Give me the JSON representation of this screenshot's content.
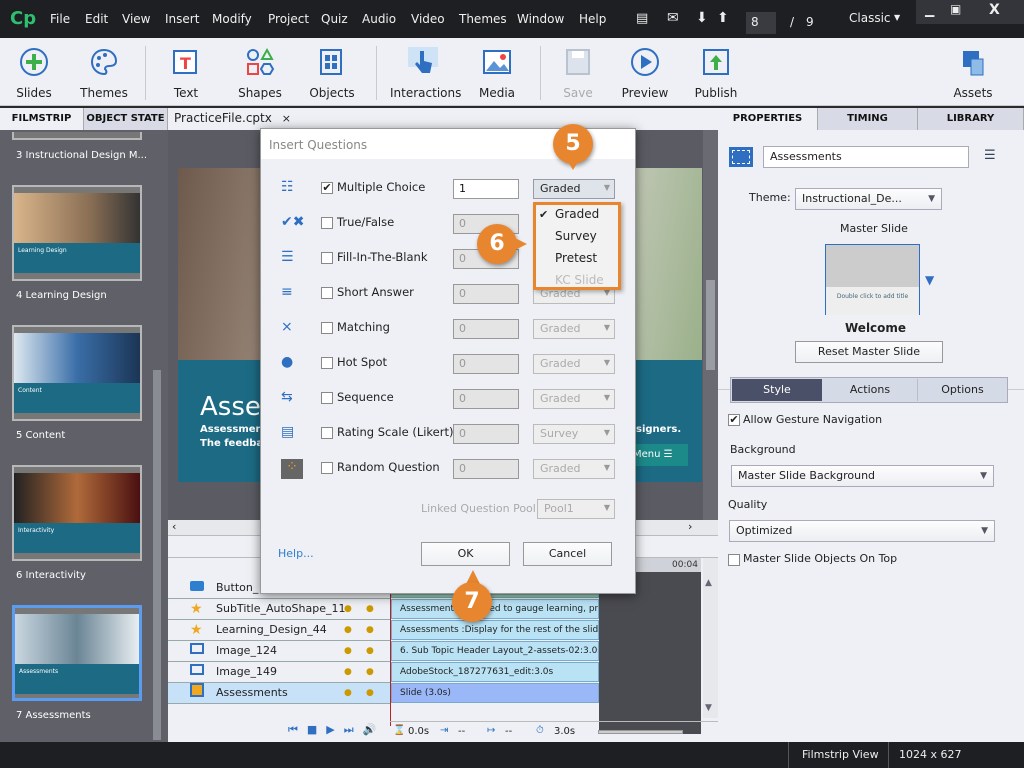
{
  "app": {
    "logo": "Cp",
    "menu": [
      "File",
      "Edit",
      "View",
      "Insert",
      "Modify",
      "Project",
      "Quiz",
      "Audio",
      "Video",
      "Themes",
      "Window",
      "Help"
    ],
    "slide_current": "8",
    "slide_sep": "/",
    "slide_total": "9",
    "workspace": "Classic"
  },
  "toolbar": {
    "items": [
      {
        "label": "Slides",
        "icon": "plus-circle-icon"
      },
      {
        "label": "Themes",
        "icon": "palette-icon"
      },
      {
        "label": "Text",
        "icon": "text-icon"
      },
      {
        "label": "Shapes",
        "icon": "shapes-icon"
      },
      {
        "label": "Objects",
        "icon": "objects-icon"
      },
      {
        "label": "Interactions",
        "icon": "hand-pointer-icon"
      },
      {
        "label": "Media",
        "icon": "image-icon"
      },
      {
        "label": "Save",
        "icon": "floppy-icon"
      },
      {
        "label": "Preview",
        "icon": "play-circle-icon"
      },
      {
        "label": "Publish",
        "icon": "upload-icon"
      },
      {
        "label": "Assets",
        "icon": "assets-icon"
      }
    ]
  },
  "left_tabs": [
    "FILMSTRIP",
    "OBJECT STATE"
  ],
  "doc_tab": {
    "label": "PracticeFile.cptx",
    "close": "×"
  },
  "right_tabs": [
    "PROPERTIES",
    "TIMING",
    "LIBRARY"
  ],
  "filmstrip": {
    "slides": [
      {
        "label": "3 Instructional Design M..."
      },
      {
        "label": "4 Learning Design",
        "title": "Learning Design"
      },
      {
        "label": "5 Content",
        "title": "Content"
      },
      {
        "label": "6 Interactivity",
        "title": "Interactivity"
      },
      {
        "label": "7 Assessments",
        "title": "Assessments"
      }
    ]
  },
  "stage": {
    "title": "Assess",
    "line1": "Assessments",
    "line2": "The feedback",
    "right_text": "signers.",
    "menu": "Menu"
  },
  "timeline": {
    "rows": [
      {
        "name": "Button_",
        "icon": "button-icon",
        "bar": ""
      },
      {
        "name": "SubTitle_AutoShape_11",
        "icon": "star-icon",
        "bar": "Assessments are used to gauge learning, pr..."
      },
      {
        "name": "Learning_Design_44",
        "icon": "star-icon",
        "bar": "Assessments :Display for the rest of the slide"
      },
      {
        "name": "Image_124",
        "icon": "image-icon",
        "bar": "6. Sub Topic Header Layout_2-assets-02:3.0s"
      },
      {
        "name": "Image_149",
        "icon": "image-icon",
        "bar": "AdobeStock_187277631_edit:3.0s"
      },
      {
        "name": "Assessments",
        "icon": "slide-icon",
        "bar": "Slide (3.0s)",
        "selected": true
      }
    ],
    "ruler": "00:04",
    "start": "0.0s",
    "fade_in": "--",
    "fade_out": "--",
    "duration": "3.0s"
  },
  "properties": {
    "name": "Assessments",
    "theme_label": "Theme:",
    "theme": "Instructional_De...",
    "master_label": "Master Slide",
    "master_thumb_text": "Double click to add title",
    "master_name": "Welcome",
    "reset": "Reset Master Slide",
    "tabs": [
      "Style",
      "Actions",
      "Options"
    ],
    "gesture": "Allow Gesture Navigation",
    "gesture_checked": true,
    "bg_label": "Background",
    "bg": "Master Slide Background",
    "quality_label": "Quality",
    "quality": "Optimized",
    "master_top": "Master Slide Objects On Top",
    "master_top_checked": false
  },
  "status": {
    "view": "Filmstrip View",
    "size": "1024 x 627"
  },
  "dialog": {
    "title": "Insert Questions",
    "rows": [
      {
        "label": "Multiple Choice",
        "checked": true,
        "count": "1",
        "type": "Graded",
        "icon": "multiple-choice-icon"
      },
      {
        "label": "True/False",
        "checked": false,
        "count": "0",
        "type": "Graded",
        "icon": "true-false-icon"
      },
      {
        "label": "Fill-In-The-Blank",
        "checked": false,
        "count": "0",
        "type": "Graded",
        "icon": "fill-blank-icon"
      },
      {
        "label": "Short Answer",
        "checked": false,
        "count": "0",
        "type": "Graded",
        "icon": "short-answer-icon"
      },
      {
        "label": "Matching",
        "checked": false,
        "count": "0",
        "type": "Graded",
        "icon": "matching-icon"
      },
      {
        "label": "Hot Spot",
        "checked": false,
        "count": "0",
        "type": "Graded",
        "icon": "hot-spot-icon"
      },
      {
        "label": "Sequence",
        "checked": false,
        "count": "0",
        "type": "Graded",
        "icon": "sequence-icon"
      },
      {
        "label": "Rating Scale (Likert)",
        "checked": false,
        "count": "0",
        "type": "Survey",
        "icon": "rating-scale-icon"
      },
      {
        "label": "Random Question",
        "checked": false,
        "count": "0",
        "type": "Graded",
        "icon": "random-question-icon"
      }
    ],
    "pool_label": "Linked Question Pool:",
    "pool": "Pool1",
    "help": "Help...",
    "ok": "OK",
    "cancel": "Cancel",
    "dropdown": {
      "options": [
        "Graded",
        "Survey",
        "Pretest",
        "KC Slide"
      ],
      "selected": "Graded",
      "disabled": "KC Slide"
    }
  },
  "callouts": [
    "5",
    "6",
    "7"
  ],
  "colors": {
    "accent": "#e8862f",
    "teal": "#1c6a84",
    "selection": "#3a7fd0"
  }
}
